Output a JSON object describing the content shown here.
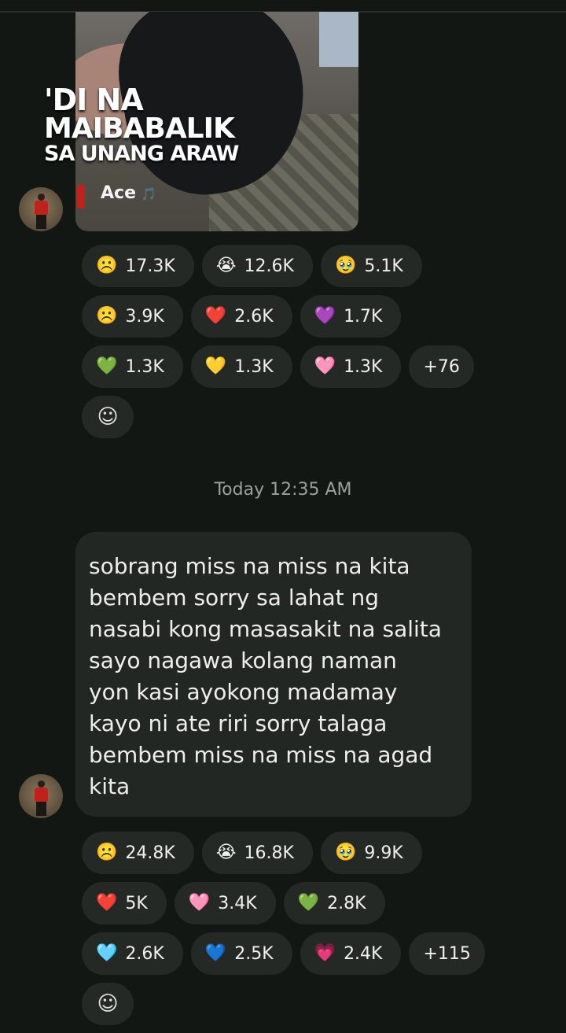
{
  "post": {
    "overlay_line1": "'DI NA",
    "overlay_line2": "MAIBABALIK",
    "overlay_line3": "SA UNANG ARAW",
    "sign_name": "Ace",
    "sign_note": "🎵"
  },
  "reactions_1": {
    "rows": [
      [
        {
          "emoji": "☹️",
          "count": "17.3K"
        },
        {
          "emoji": "😭",
          "count": "12.6K"
        },
        {
          "emoji": "🥹",
          "count": "5.1K"
        }
      ],
      [
        {
          "emoji": "☹️",
          "count": "3.9K"
        },
        {
          "emoji": "❤️",
          "count": "2.6K"
        },
        {
          "emoji": "💜",
          "count": "1.7K"
        }
      ],
      [
        {
          "emoji": "💚",
          "count": "1.3K"
        },
        {
          "emoji": "💛",
          "count": "1.3K"
        },
        {
          "emoji": "🩷",
          "count": "1.3K"
        }
      ]
    ],
    "more": "+76",
    "add_icon": "☺"
  },
  "timestamp": "Today 12:35 AM",
  "message": {
    "lines": [
      "sobrang miss na miss na kita",
      "bembem sorry sa lahat ng",
      "nasabi kong masasakit na salita",
      "sayo nagawa kolang naman",
      "yon kasi ayokong madamay",
      "kayo ni ate riri sorry talaga",
      "bembem miss na miss na agad",
      "kita"
    ]
  },
  "reactions_2": {
    "rows": [
      [
        {
          "emoji": "☹️",
          "count": "24.8K"
        },
        {
          "emoji": "😭",
          "count": "16.8K"
        },
        {
          "emoji": "🥹",
          "count": "9.9K"
        }
      ],
      [
        {
          "emoji": "❤️",
          "count": "5K"
        },
        {
          "emoji": "🩷",
          "count": "3.4K"
        },
        {
          "emoji": "💚",
          "count": "2.8K"
        }
      ],
      [
        {
          "emoji": "🩵",
          "count": "2.6K"
        },
        {
          "emoji": "💙",
          "count": "2.5K"
        },
        {
          "emoji": "💗",
          "count": "2.4K"
        }
      ]
    ],
    "more": "+115",
    "add_icon": "☺"
  }
}
